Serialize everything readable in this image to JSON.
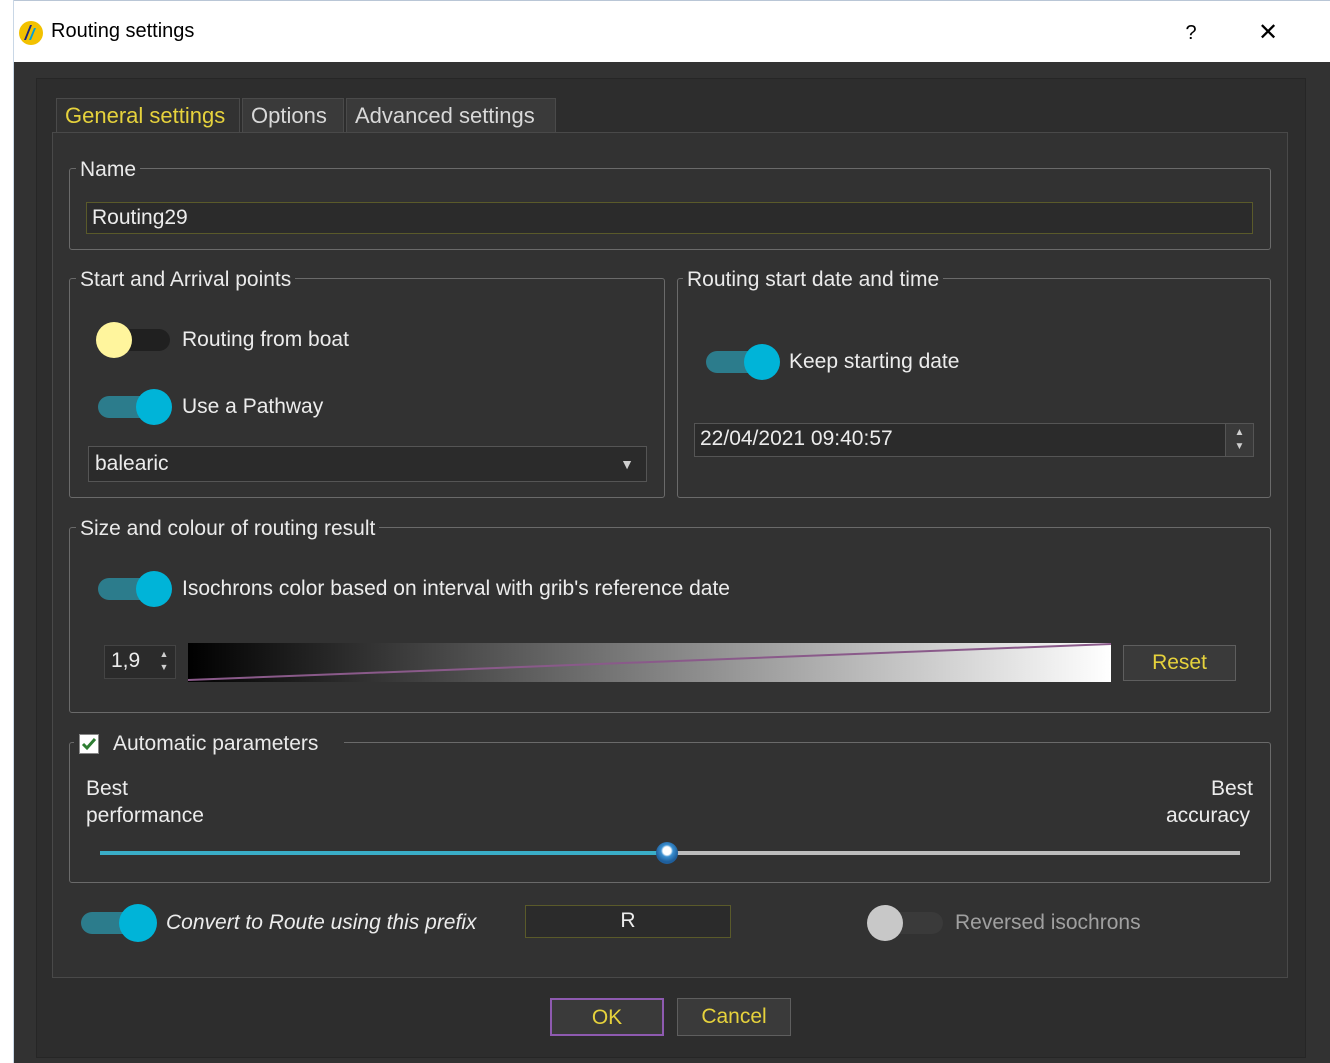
{
  "window": {
    "title": "Routing settings",
    "help_label": "?",
    "close_label": "✕",
    "app_icon": "app-logo-icon"
  },
  "tabs": [
    {
      "label": "General settings",
      "active": true
    },
    {
      "label": "Options",
      "active": false
    },
    {
      "label": "Advanced settings",
      "active": false
    }
  ],
  "name_group": {
    "title": "Name",
    "value": "Routing29"
  },
  "start_group": {
    "title": "Start and Arrival points",
    "routing_from_boat": {
      "label": "Routing from boat",
      "on": false
    },
    "use_pathway": {
      "label": "Use a Pathway",
      "on": true
    },
    "pathway_value": "balearic"
  },
  "date_group": {
    "title": "Routing start date and time",
    "keep_starting": {
      "label": "Keep starting date",
      "on": true
    },
    "datetime_value": "22/04/2021 09:40:57"
  },
  "result_group": {
    "title": "Size and colour of routing result",
    "isochron_toggle": {
      "label": "Isochrons color based on interval with grib's reference date",
      "on": true
    },
    "width_value": "1,9",
    "reset_label": "Reset"
  },
  "auto_group": {
    "title": "Automatic parameters",
    "checked": true,
    "left_label_1": "Best",
    "left_label_2": "performance",
    "right_label_1": "Best",
    "right_label_2": "accuracy",
    "slider_value_fraction": 0.5
  },
  "bottom": {
    "convert_toggle": {
      "label": "Convert to Route using this prefix",
      "on": true
    },
    "prefix_value": "R",
    "reversed_toggle": {
      "label": "Reversed isochrons",
      "on": false
    }
  },
  "buttons": {
    "ok_label": "OK",
    "cancel_label": "Cancel"
  },
  "colors": {
    "accent": "#00b4d8",
    "toggle_track_on": "#2c7c8c",
    "text_highlight": "#e6d23c",
    "knob_off_yellow": "#fff59d",
    "knob_off_gray": "#c8c8c8"
  }
}
